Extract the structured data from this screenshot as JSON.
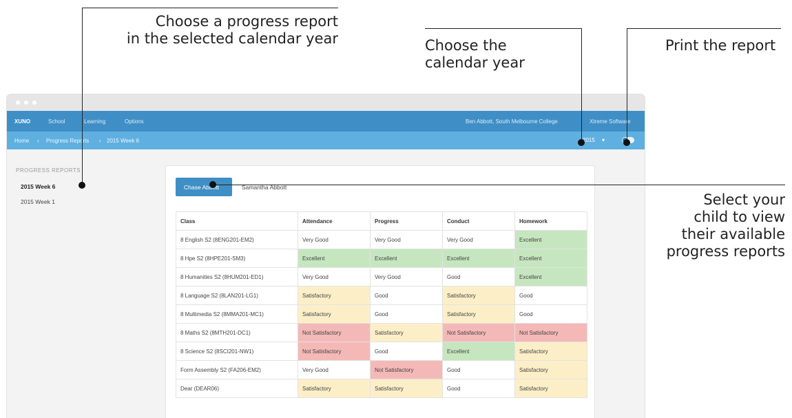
{
  "callouts": {
    "progress_report": [
      "Choose a progress report",
      "in the selected calendar year"
    ],
    "calendar_year": [
      "Choose the",
      "calendar year"
    ],
    "print": "Print the report",
    "select_child": [
      "Select your",
      "child to view",
      "their available",
      "progress reports"
    ]
  },
  "navbar": {
    "brand": "XUNO",
    "menu": [
      "School",
      "Learning",
      "Options"
    ],
    "user": "Ben Abbott, South Melbourne College",
    "vendor": "Xtreme Software"
  },
  "breadcrumb": [
    "Home",
    "Progress Reports",
    "2015 Week 6"
  ],
  "breadcrumb_separator": "›",
  "year_select": {
    "value": "2015",
    "caret": "▾"
  },
  "sidebar": {
    "heading": "PROGRESS REPORTS",
    "items": [
      "2015 Week 6",
      "2015 Week 1"
    ]
  },
  "children": [
    "Chase Abbott",
    "Samantha Abbott"
  ],
  "table": {
    "headers": [
      "Class",
      "Attendance",
      "Progress",
      "Conduct",
      "Homework"
    ],
    "rows": [
      [
        "8 English S2 (8ENG201-EM2)",
        "Very Good",
        "Very Good",
        "Very Good",
        "Excellent"
      ],
      [
        "8 Hpe S2 (8HPE201-SM3)",
        "Excellent",
        "Excellent",
        "Excellent",
        "Excellent"
      ],
      [
        "8 Humanities S2 (8HUM201-ED1)",
        "Very Good",
        "Very Good",
        "Good",
        "Excellent"
      ],
      [
        "8 Language S2 (8LAN201-LG1)",
        "Satisfactory",
        "Good",
        "Satisfactory",
        "Good"
      ],
      [
        "8 Multimedia S2 (8MMA201-MC1)",
        "Satisfactory",
        "Good",
        "Satisfactory",
        "Good"
      ],
      [
        "8 Maths S2 (8MTH201-DC1)",
        "Not Satisfactory",
        "Satisfactory",
        "Not Satisfactory",
        "Not Satisfactory"
      ],
      [
        "8 Science S2 (8SCI201-NW1)",
        "Not Satisfactory",
        "Good",
        "Excellent",
        "Satisfactory"
      ],
      [
        "Form Assembly S2 (FA206-EM2)",
        "Very Good",
        "Not Satisfactory",
        "Good",
        "Satisfactory"
      ],
      [
        "Dear (DEAR06)",
        "Satisfactory",
        "Satisfactory",
        "Good",
        "Satisfactory"
      ]
    ]
  },
  "colors": {
    "navbar": "#3f8fc6",
    "breadcrumb_bar": "#5fb0e1",
    "excellent": "#c6e6bf",
    "satisfactory": "#fcefc8",
    "not_satisfactory": "#f4b9b7"
  }
}
